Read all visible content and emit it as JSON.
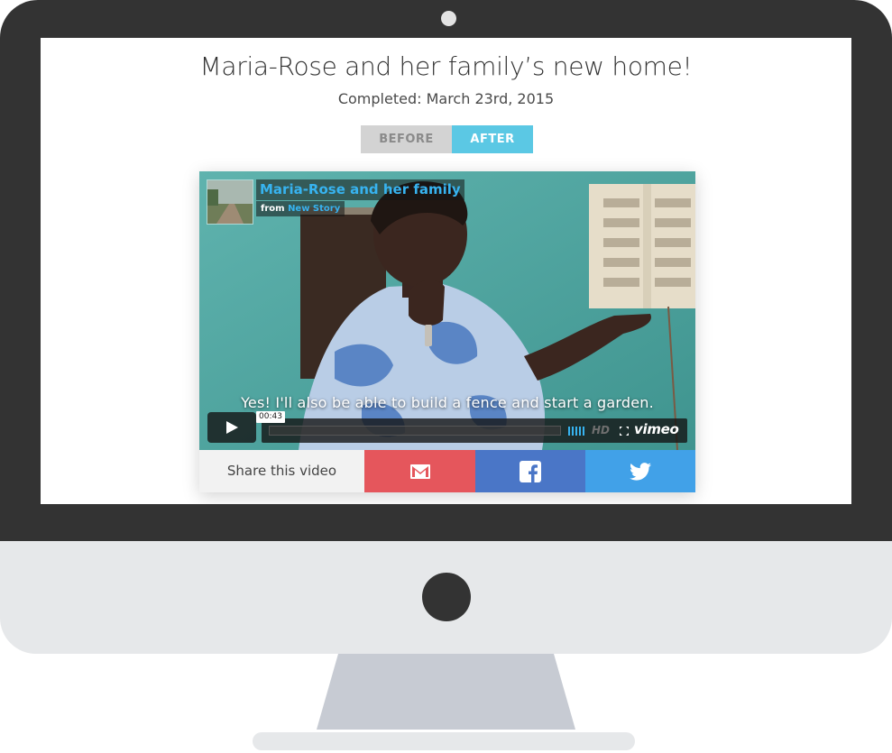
{
  "page": {
    "title": "Maria-Rose and her family’s new home!",
    "completed": "Completed: March 23rd, 2015"
  },
  "toggle": {
    "before_label": "BEFORE",
    "after_label": "AFTER",
    "selected": "AFTER"
  },
  "video": {
    "title": "Maria-Rose and her family",
    "byline_prefix": "from",
    "owner": "New Story",
    "caption": "Yes! I'll also be able to build a fence and start a garden.",
    "timecode": "00:43",
    "hd_label": "HD",
    "brand": "vimeo",
    "icons": [
      "play-icon",
      "volume-icon",
      "fullscreen-icon"
    ]
  },
  "share": {
    "label": "Share this video",
    "buttons": [
      {
        "name": "email",
        "icon": "email-icon",
        "color": "#e5565c"
      },
      {
        "name": "facebook",
        "icon": "facebook-icon",
        "color": "#4a76c7"
      },
      {
        "name": "twitter",
        "icon": "twitter-icon",
        "color": "#41a1e8"
      }
    ]
  },
  "colors": {
    "accent": "#5bc8e4",
    "vimeo_blue": "#37b3f0",
    "bezel": "#333333"
  }
}
